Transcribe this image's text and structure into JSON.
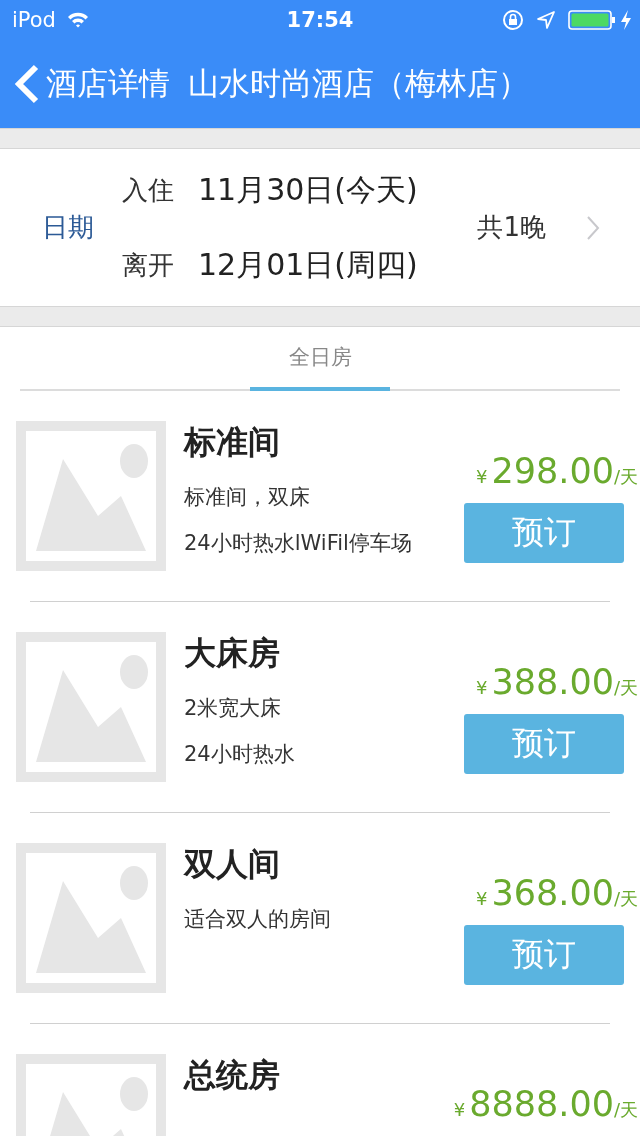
{
  "status_bar": {
    "carrier": "iPod",
    "time": "17:54"
  },
  "nav_bar": {
    "back_label": "酒店详情",
    "title": "山水时尚酒店（梅林店）"
  },
  "dates": {
    "label": "日期",
    "check_in_label": "入住",
    "check_in": "11月30日(今天)",
    "check_out_label": "离开",
    "check_out": "12月01日(周四)",
    "nights": "共1晚"
  },
  "tabs": [
    {
      "label": "全日房",
      "selected": true
    }
  ],
  "rooms": [
    {
      "name": "标准间",
      "lines": [
        "标准间，双床",
        "24小时热水lWiFil停车场"
      ],
      "currency": "¥",
      "price": "298.00",
      "unit": "/天",
      "button": "预订"
    },
    {
      "name": "大床房",
      "lines": [
        "2米宽大床",
        "24小时热水"
      ],
      "currency": "¥",
      "price": "388.00",
      "unit": "/天",
      "button": "预订"
    },
    {
      "name": "双人间",
      "lines": [
        "适合双人的房间"
      ],
      "currency": "¥",
      "price": "368.00",
      "unit": "/天",
      "button": "预订"
    },
    {
      "name": "总统房",
      "currency": "¥",
      "price": "8888.00",
      "unit": "/天"
    }
  ]
}
